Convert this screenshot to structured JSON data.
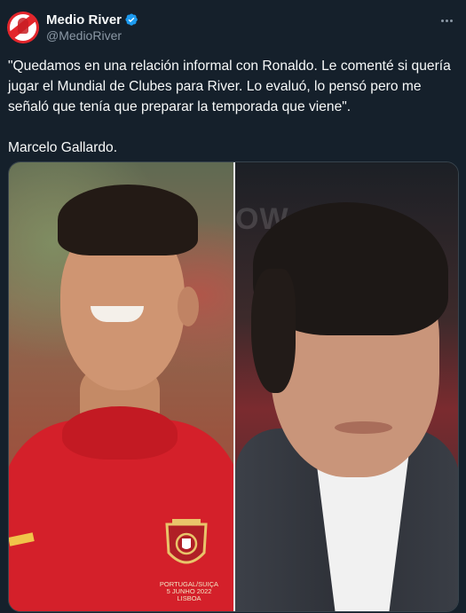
{
  "account": {
    "display_name": "Medio River",
    "handle": "@MedioRiver",
    "verified": true,
    "avatar_icon": "medio-river-logo-icon"
  },
  "tweet": {
    "text": "\"Quedamos en una relación informal con Ronaldo. Le comenté si quería jugar el Mundial de Clubes para River. Lo evaluó, lo pensó pero me señaló que tenía que preparar la temporada que viene\".",
    "signature": "Marcelo Gallardo."
  },
  "media": {
    "left_image_caption": "PORTUGAL/SUIÇA\n5 JUNHO 2022\nLISBOA",
    "right_image_sign": "OW"
  },
  "colors": {
    "background": "#15202b",
    "text": "#f7f9f9",
    "secondary": "#8b98a5",
    "verified": "#1d9bf0",
    "border": "#38444d"
  },
  "icons": {
    "more": "more-options-icon",
    "verified": "verified-badge-icon"
  }
}
